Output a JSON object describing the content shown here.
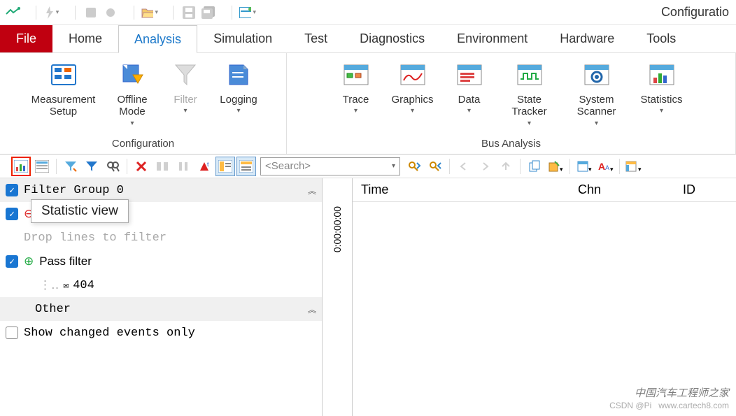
{
  "top": {
    "right_label": "Configuratio"
  },
  "tabs": {
    "file": "File",
    "items": [
      "Home",
      "Analysis",
      "Simulation",
      "Test",
      "Diagnostics",
      "Environment",
      "Hardware",
      "Tools"
    ],
    "active_index": 1
  },
  "ribbon": {
    "groups": [
      {
        "label": "Configuration",
        "buttons": [
          {
            "label": "Measurement Setup",
            "icon": "measurement-setup-icon",
            "dropdown": false
          },
          {
            "label": "Offline Mode",
            "icon": "offline-mode-icon",
            "dropdown": true
          },
          {
            "label": "Filter",
            "icon": "filter-icon",
            "dropdown": true,
            "disabled": true
          },
          {
            "label": "Logging",
            "icon": "logging-icon",
            "dropdown": true
          }
        ]
      },
      {
        "label": "Bus Analysis",
        "buttons": [
          {
            "label": "Trace",
            "icon": "trace-icon",
            "dropdown": true
          },
          {
            "label": "Graphics",
            "icon": "graphics-icon",
            "dropdown": true
          },
          {
            "label": "Data",
            "icon": "data-icon",
            "dropdown": true
          },
          {
            "label": "State Tracker",
            "icon": "state-tracker-icon",
            "dropdown": true
          },
          {
            "label": "System Scanner",
            "icon": "system-scanner-icon",
            "dropdown": true
          },
          {
            "label": "Statistics",
            "icon": "statistics-icon",
            "dropdown": true
          }
        ]
      }
    ]
  },
  "sub_toolbar": {
    "tooltip": "Statistic view",
    "search_placeholder": "<Search>"
  },
  "filter_panel": {
    "group0": "Filter Group 0",
    "stop": "Stop filter",
    "hint": "Drop lines to filter",
    "pass": "Pass filter",
    "pass_item": "404",
    "other": "Other",
    "show_changed": "Show changed events only"
  },
  "timeline": {
    "start": "0:00:00:00"
  },
  "columns": {
    "time": "Time",
    "chn": "Chn",
    "id": "ID"
  },
  "watermark": {
    "cn": "中国汽车工程师之家",
    "en": "www.cartech8.com",
    "csdn": "CSDN @Pi"
  }
}
